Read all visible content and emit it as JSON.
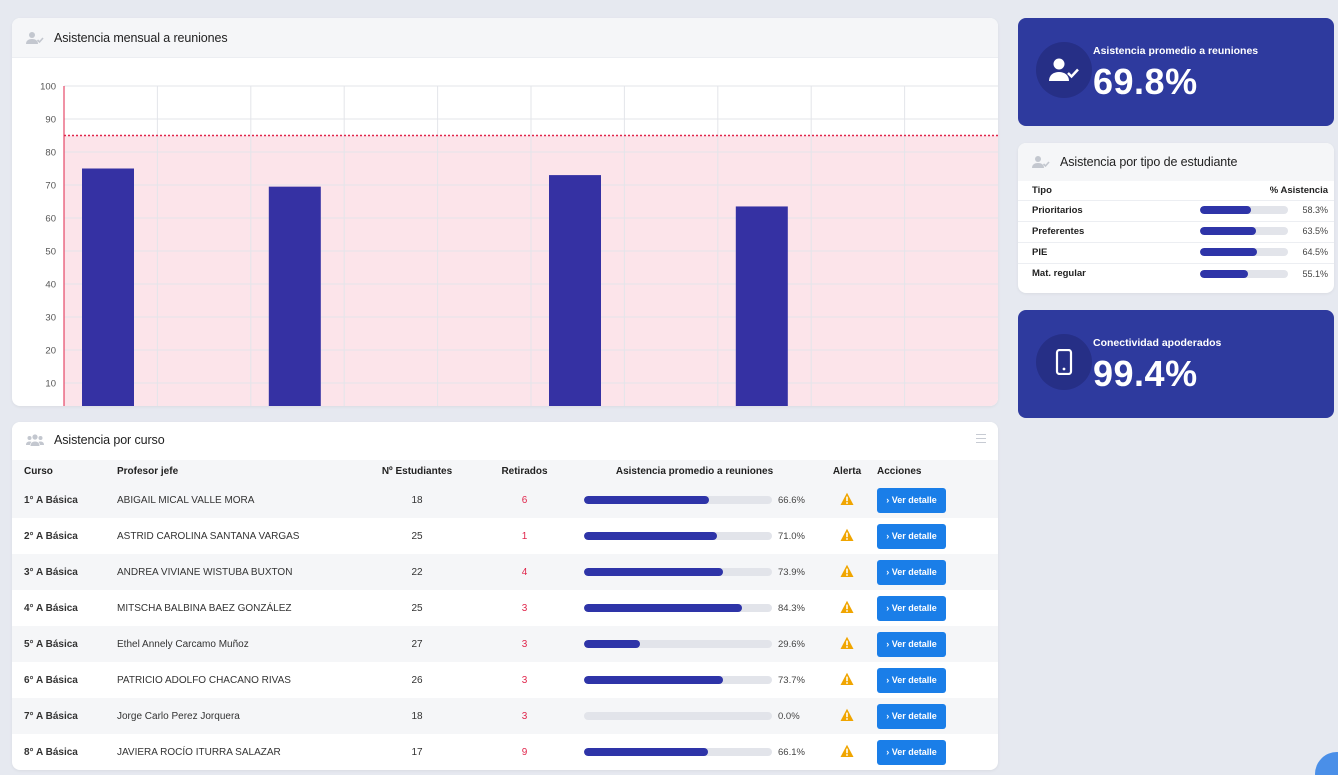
{
  "chart_card": {
    "title": "Asistencia mensual a reuniones",
    "icon": "user-check-icon"
  },
  "chart_data": {
    "type": "bar",
    "title": "Asistencia mensual a reuniones",
    "xlabel": "",
    "ylabel": "",
    "ylim": [
      0,
      100
    ],
    "yticks": [
      10,
      20,
      30,
      40,
      50,
      60,
      70,
      80,
      90,
      100
    ],
    "target_line": 85,
    "grid": true,
    "bar_color": "#3531a3",
    "band_color": "#fce4ea",
    "line_color": "#e0254b",
    "slots": 10,
    "bars": [
      {
        "slot": 0,
        "value": 75
      },
      {
        "slot": 2,
        "value": 69.5
      },
      {
        "slot": 5,
        "value": 73
      },
      {
        "slot": 7,
        "value": 63.5
      }
    ]
  },
  "table_card": {
    "title": "Asistencia por curso",
    "icon": "users-icon",
    "headers": {
      "curso": "Curso",
      "profesor": "Profesor jefe",
      "estudiantes": "Nº Estudiantes",
      "retirados": "Retirados",
      "asistencia": "Asistencia promedio a reuniones",
      "alerta": "Alerta",
      "acciones": "Acciones"
    },
    "button_label": "› Ver detalle",
    "rows": [
      {
        "curso": "1° A Básica",
        "profesor": "ABIGAIL MICAL VALLE MORA",
        "estudiantes": "18",
        "retirados": "6",
        "pct": 66.6,
        "pct_label": "66.6%"
      },
      {
        "curso": "2° A Básica",
        "profesor": "ASTRID CAROLINA SANTANA VARGAS",
        "estudiantes": "25",
        "retirados": "1",
        "pct": 71.0,
        "pct_label": "71.0%"
      },
      {
        "curso": "3° A Básica",
        "profesor": "ANDREA VIVIANE WISTUBA BUXTON",
        "estudiantes": "22",
        "retirados": "4",
        "pct": 73.9,
        "pct_label": "73.9%"
      },
      {
        "curso": "4° A Básica",
        "profesor": "MITSCHA BALBINA BAEZ GONZÁLEZ",
        "estudiantes": "25",
        "retirados": "3",
        "pct": 84.3,
        "pct_label": "84.3%"
      },
      {
        "curso": "5° A Básica",
        "profesor": "Ethel Annely Carcamo Muñoz",
        "estudiantes": "27",
        "retirados": "3",
        "pct": 29.6,
        "pct_label": "29.6%"
      },
      {
        "curso": "6° A Básica",
        "profesor": "PATRICIO ADOLFO CHACANO RIVAS",
        "estudiantes": "26",
        "retirados": "3",
        "pct": 73.7,
        "pct_label": "73.7%"
      },
      {
        "curso": "7° A Básica",
        "profesor": "Jorge Carlo Perez Jorquera",
        "estudiantes": "18",
        "retirados": "3",
        "pct": 0.0,
        "pct_label": "0.0%"
      },
      {
        "curso": "8° A Básica",
        "profesor": "JAVIERA ROCÍO ITURRA SALAZAR",
        "estudiantes": "17",
        "retirados": "9",
        "pct": 66.1,
        "pct_label": "66.1%"
      }
    ]
  },
  "stat_asistencia": {
    "label": "Asistencia promedio a reuniones",
    "value": "69.8%",
    "icon": "user-check-icon"
  },
  "tipo_card": {
    "title": "Asistencia por tipo de estudiante",
    "icon": "user-check-icon",
    "headers": {
      "tipo": "Tipo",
      "pct": "% Asistencia"
    },
    "rows": [
      {
        "tipo": "Prioritarios",
        "pct": 58.3,
        "label": "58.3%"
      },
      {
        "tipo": "Preferentes",
        "pct": 63.5,
        "label": "63.5%"
      },
      {
        "tipo": "PIE",
        "pct": 64.5,
        "label": "64.5%"
      },
      {
        "tipo": "Mat. regular",
        "pct": 55.1,
        "label": "55.1%"
      }
    ]
  },
  "stat_conect": {
    "label": "Conectividad apoderados",
    "value": "99.4%",
    "icon": "mobile-phone-icon"
  },
  "colors": {
    "primary": "#2e3a9e",
    "bar": "#2e34a8",
    "button": "#1a7ee8",
    "danger": "#e0254b",
    "warning": "#f0a500"
  }
}
